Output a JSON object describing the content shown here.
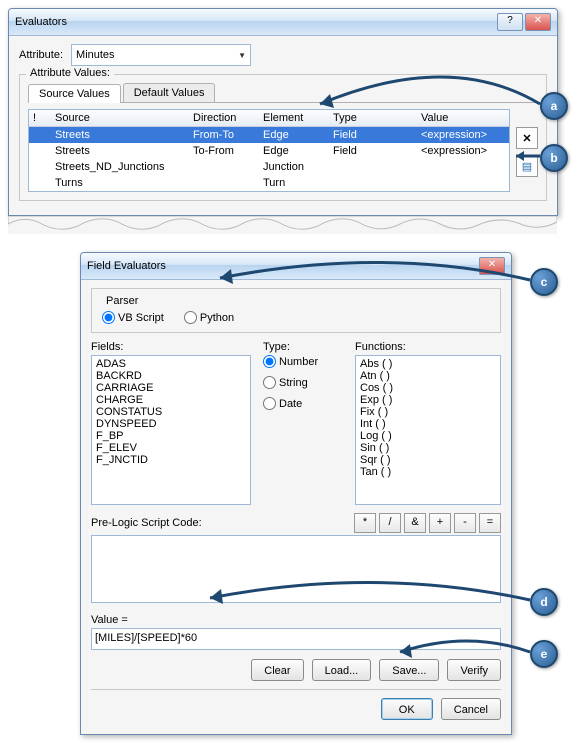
{
  "evaluators": {
    "title": "Evaluators",
    "attribute_label": "Attribute:",
    "attribute_value": "Minutes",
    "attribute_values_label": "Attribute Values:",
    "tabs": {
      "source": "Source Values",
      "default": "Default Values"
    },
    "columns": {
      "bang": "!",
      "source": "Source",
      "direction": "Direction",
      "element": "Element",
      "type": "Type",
      "value": "Value"
    },
    "rows": [
      {
        "source": "Streets",
        "direction": "From-To",
        "element": "Edge",
        "type": "Field",
        "value": "<expression>"
      },
      {
        "source": "Streets",
        "direction": "To-From",
        "element": "Edge",
        "type": "Field",
        "value": "<expression>"
      },
      {
        "source": "Streets_ND_Junctions",
        "direction": "",
        "element": "Junction",
        "type": "",
        "value": ""
      },
      {
        "source": "Turns",
        "direction": "",
        "element": "Turn",
        "type": "",
        "value": ""
      }
    ]
  },
  "field_eval": {
    "title": "Field Evaluators",
    "parser_label": "Parser",
    "parser_vb": "VB Script",
    "parser_py": "Python",
    "fields_label": "Fields:",
    "fields": [
      "ADAS",
      "BACKRD",
      "CARRIAGE",
      "CHARGE",
      "CONSTATUS",
      "DYNSPEED",
      "F_BP",
      "F_ELEV",
      "F_JNCTID"
    ],
    "type_label": "Type:",
    "type_options": {
      "number": "Number",
      "string": "String",
      "date": "Date"
    },
    "functions_label": "Functions:",
    "functions": [
      "Abs ( )",
      "Atn ( )",
      "Cos ( )",
      "Exp ( )",
      "Fix ( )",
      "Int ( )",
      "Log ( )",
      "Sin ( )",
      "Sqr ( )",
      "Tan ( )"
    ],
    "prelogic_label": "Pre-Logic Script Code:",
    "ops": [
      "*",
      "/",
      "&",
      "+",
      "-",
      "="
    ],
    "value_label": "Value =",
    "value_expr": "[MILES]/[SPEED]*60",
    "buttons": {
      "clear": "Clear",
      "load": "Load...",
      "save": "Save...",
      "verify": "Verify",
      "ok": "OK",
      "cancel": "Cancel"
    }
  },
  "callouts": {
    "a": "a",
    "b": "b",
    "c": "c",
    "d": "d",
    "e": "e"
  }
}
